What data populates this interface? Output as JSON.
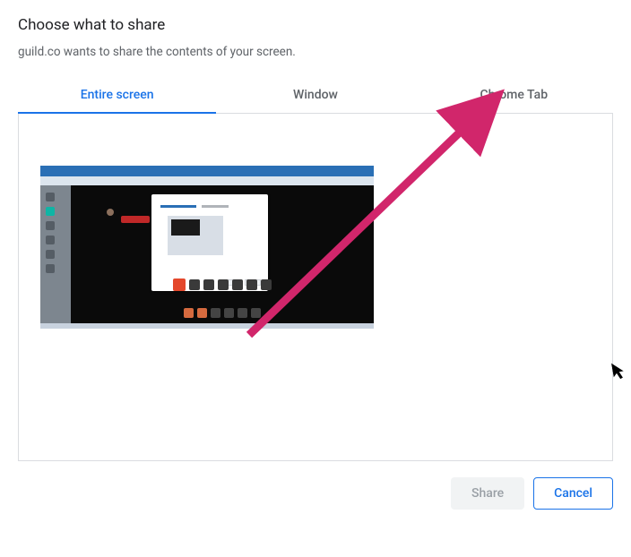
{
  "dialog": {
    "title": "Choose what to share",
    "subtitle": "guild.co wants to share the contents of your screen."
  },
  "tabs": {
    "entire_screen": "Entire screen",
    "window": "Window",
    "chrome_tab": "Chrome Tab"
  },
  "buttons": {
    "share": "Share",
    "cancel": "Cancel"
  },
  "annotation": {
    "arrow_color": "#d1266b",
    "target": "chrome-tab"
  }
}
